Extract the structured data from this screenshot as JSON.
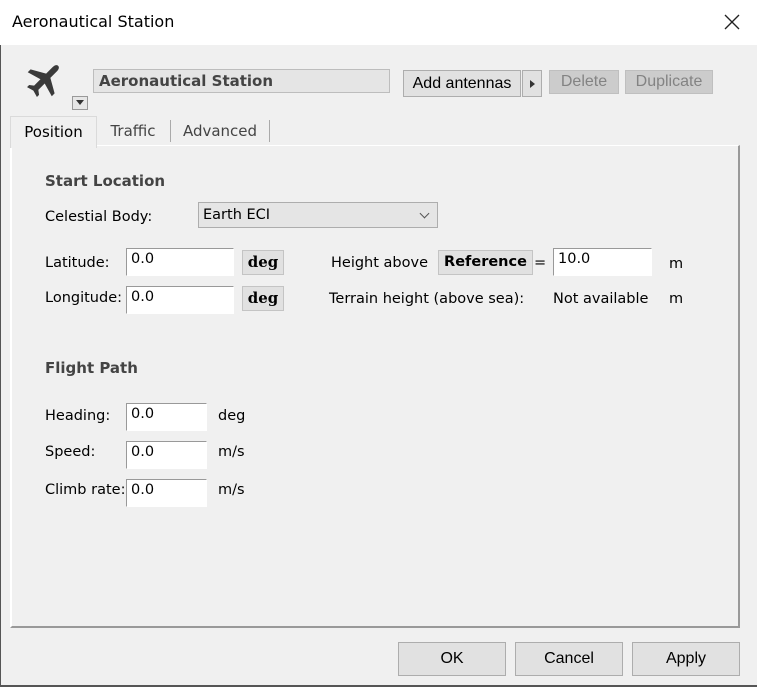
{
  "window": {
    "title": "Aeronautical Station",
    "close_icon": "close-icon"
  },
  "header": {
    "station_icon": "airplane-icon",
    "station_name": "Aeronautical Station",
    "buttons": {
      "add_antennas": "Add antennas",
      "delete": "Delete",
      "duplicate": "Duplicate"
    }
  },
  "tabs": [
    {
      "label": "Position",
      "active": true
    },
    {
      "label": "Traffic",
      "active": false
    },
    {
      "label": "Advanced",
      "active": false
    }
  ],
  "start_location": {
    "heading": "Start Location",
    "celestial_body_label": "Celestial Body:",
    "celestial_body_value": "Earth ECI",
    "latitude_label": "Latitude:",
    "latitude_value": "0.0",
    "latitude_unit": "deg",
    "longitude_label": "Longitude:",
    "longitude_value": "0.0",
    "longitude_unit": "deg",
    "height_label": "Height above",
    "height_reference": "Reference",
    "height_equals": "=",
    "height_value": "10.0",
    "height_unit": "m",
    "terrain_label": "Terrain height (above sea):",
    "terrain_value": "Not available",
    "terrain_unit": "m"
  },
  "flight_path": {
    "heading": "Flight Path",
    "heading_label": "Heading:",
    "heading_value": "0.0",
    "heading_unit": "deg",
    "speed_label": "Speed:",
    "speed_value": "0.0",
    "speed_unit": "m/s",
    "climb_label": "Climb rate:",
    "climb_value": "0.0",
    "climb_unit": "m/s"
  },
  "footer": {
    "ok": "OK",
    "cancel": "Cancel",
    "apply": "Apply"
  }
}
